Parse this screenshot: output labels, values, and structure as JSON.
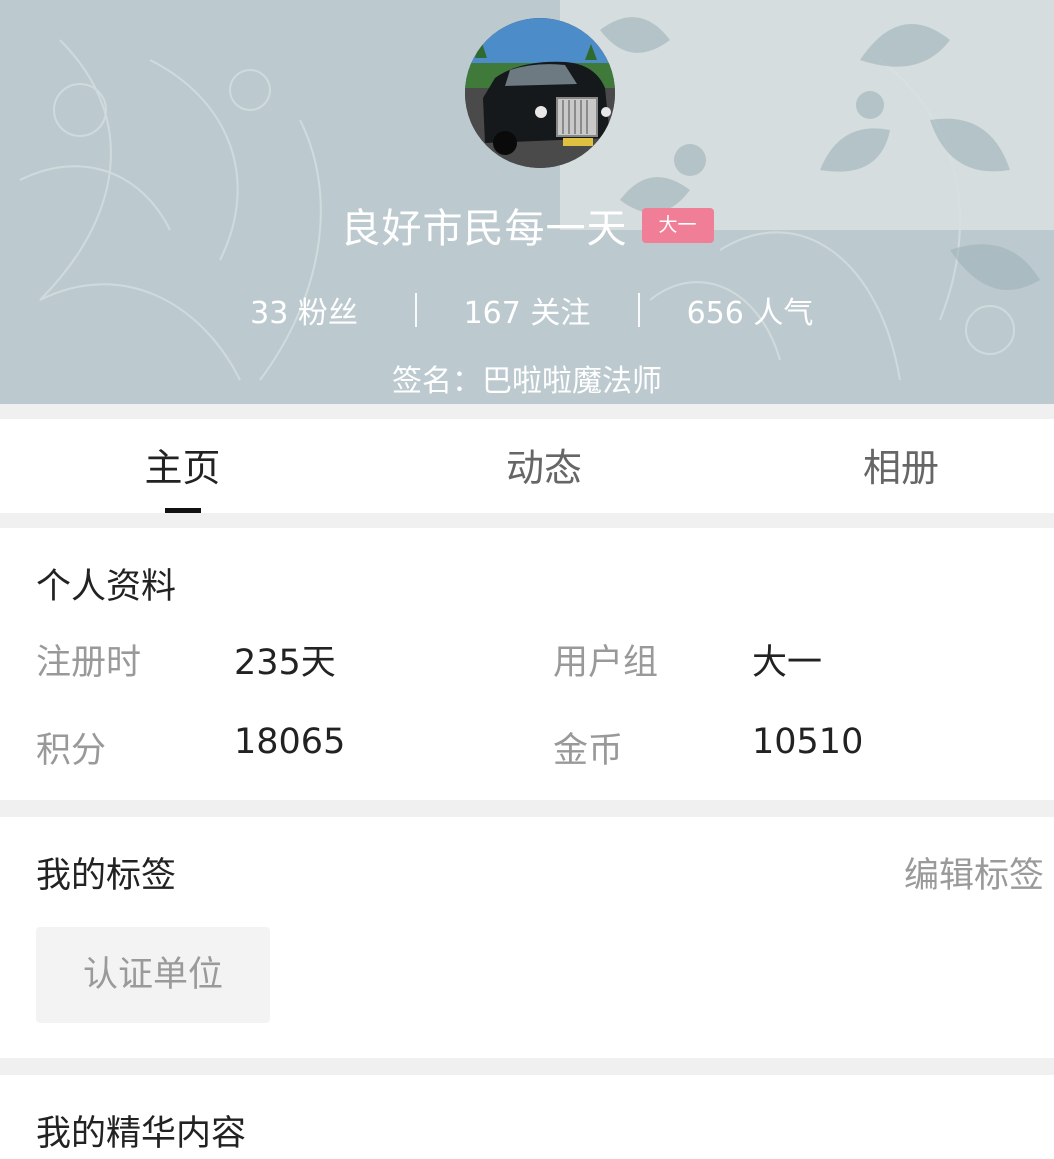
{
  "profile": {
    "username": "良好市民每一天",
    "level_badge": "大一",
    "badge_color": "#f07e97",
    "header_bg_color": "#bccacf",
    "stats": [
      {
        "label": "33 粉丝"
      },
      {
        "label": "167 关注"
      },
      {
        "label": "656 人气"
      }
    ],
    "signature": "签名：巴啦啦魔法师"
  },
  "tabs": [
    {
      "label": "主页",
      "active": true
    },
    {
      "label": "动态",
      "active": false
    },
    {
      "label": "相册",
      "active": false
    }
  ],
  "personal_info": {
    "title": "个人资料",
    "fields": [
      {
        "label": "注册时",
        "value": "235天"
      },
      {
        "label": "用户组",
        "value": "大一"
      },
      {
        "label": "积分",
        "value": "18065"
      },
      {
        "label": "金币",
        "value": "10510"
      }
    ]
  },
  "tags": {
    "title": "我的标签",
    "edit_label": "编辑标签",
    "items": [
      "认证单位"
    ]
  },
  "featured": {
    "title": "我的精华内容"
  }
}
